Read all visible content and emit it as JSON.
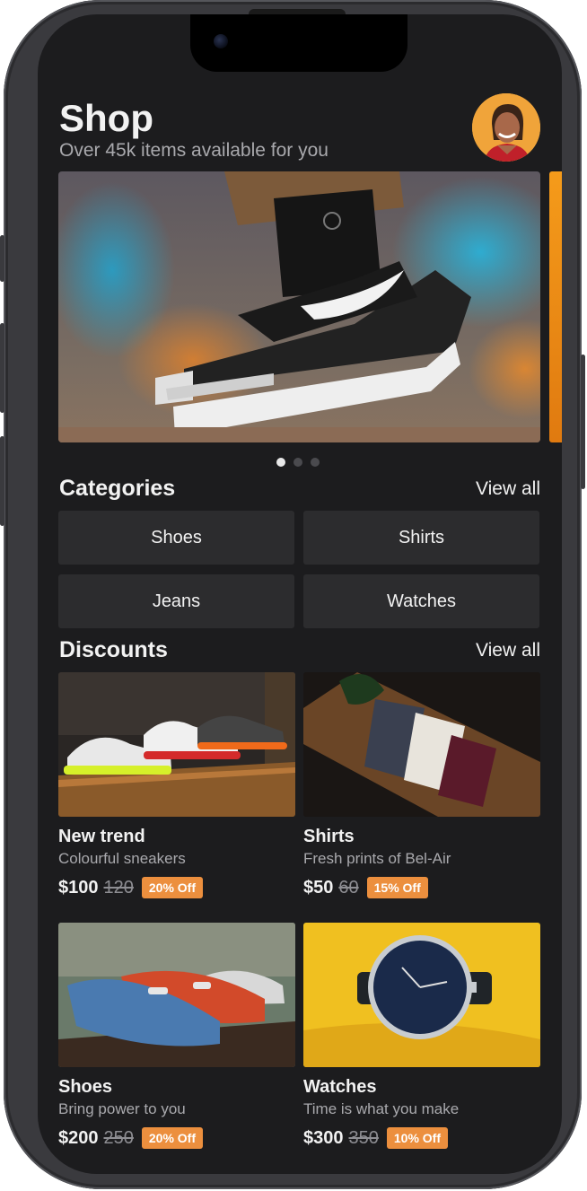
{
  "header": {
    "title": "Shop",
    "subtitle": "Over 45k items available for you"
  },
  "carousel": {
    "total_slides": 3,
    "active_index": 0
  },
  "categories": {
    "title": "Categories",
    "view_all": "View all",
    "items": [
      "Shoes",
      "Shirts",
      "Jeans",
      "Watches"
    ]
  },
  "discounts": {
    "title": "Discounts",
    "view_all": "View all",
    "items": [
      {
        "name": "New trend",
        "description": "Colourful sneakers",
        "price": "$100",
        "old_price": "120",
        "badge": "20% Off"
      },
      {
        "name": "Shirts",
        "description": "Fresh prints of Bel-Air",
        "price": "$50",
        "old_price": "60",
        "badge": "15% Off"
      },
      {
        "name": "Shoes",
        "description": "Bring power to you",
        "price": "$200",
        "old_price": "250",
        "badge": "20% Off"
      },
      {
        "name": "Watches",
        "description": "Time is what you make",
        "price": "$300",
        "old_price": "350",
        "badge": "10% Off"
      }
    ]
  },
  "colors": {
    "background": "#1c1c1e",
    "tile": "#2c2c2e",
    "badge": "#ec8f3e",
    "text": "#f2f2f2",
    "muted": "#a9a9ad"
  }
}
